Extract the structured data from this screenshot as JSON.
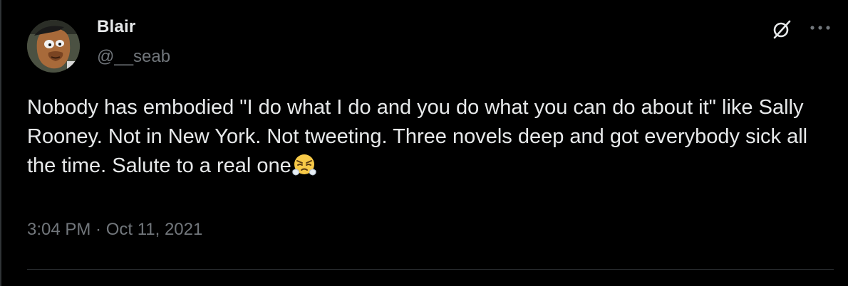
{
  "author": {
    "display_name": "Blair",
    "handle": "@__seab",
    "avatar_icon": "cartoon-avatar-icon"
  },
  "header_actions": {
    "grok_icon": "grok-slash-icon",
    "more_icon": "more-options-icon"
  },
  "tweet": {
    "text": "Nobody has embodied \"I do what I do and you do what you can do about it\" like Sally Rooney. Not in New York. Not tweeting. Three novels deep and got everybody sick all the time. Salute to a real one",
    "emoji": "face-with-steam-from-nose",
    "timestamp": "3:04 PM · Oct 11, 2021"
  },
  "colors": {
    "background": "#000000",
    "primary_text": "#e7e9ea",
    "secondary_text": "#71767b",
    "border": "#2f3336"
  }
}
